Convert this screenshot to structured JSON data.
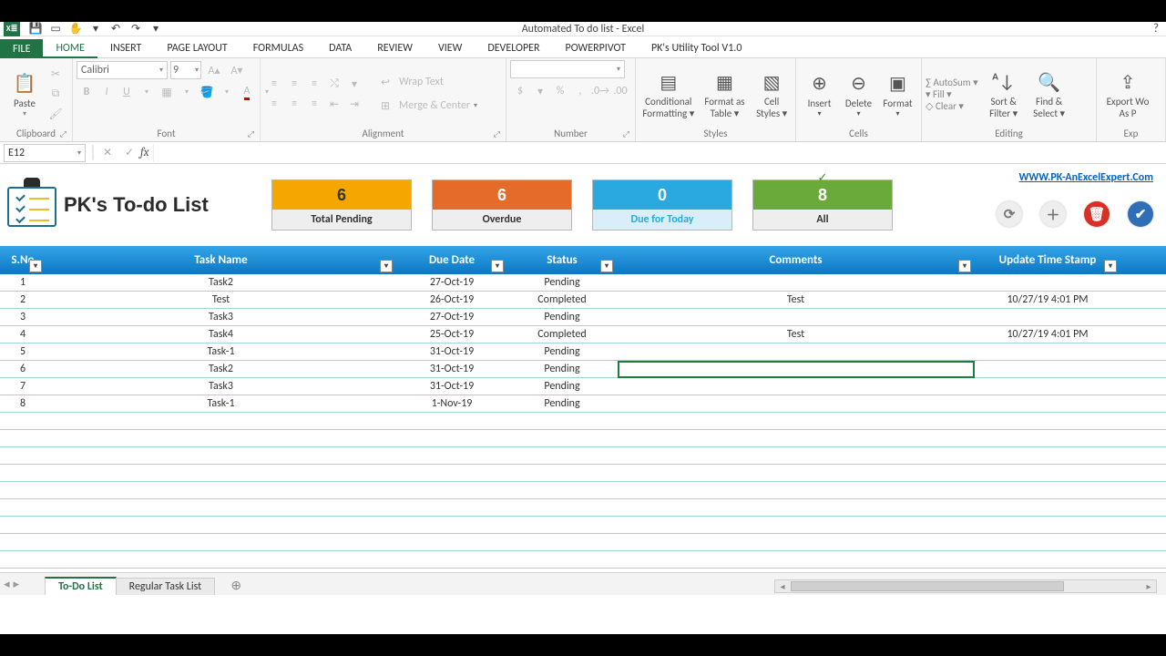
{
  "app_title": "Automated To do list - Excel",
  "qat": {
    "items": [
      "save-icon",
      "quickprint-icon",
      "touch-icon",
      "new-icon",
      "undo-icon",
      "redo-icon",
      "customize-icon"
    ]
  },
  "tabs": [
    "FILE",
    "HOME",
    "INSERT",
    "PAGE LAYOUT",
    "FORMULAS",
    "DATA",
    "REVIEW",
    "VIEW",
    "DEVELOPER",
    "POWERPIVOT",
    "PK's Utility Tool V1.0"
  ],
  "active_tab": "HOME",
  "font": {
    "name": "Calibri",
    "size": "9"
  },
  "ribbon_groups": {
    "clipboard": "Clipboard",
    "font": "Font",
    "alignment": "Alignment",
    "number": "Number",
    "styles": "Styles",
    "cells": "Cells",
    "editing": "Editing",
    "export": "Exp"
  },
  "ribbon_labels": {
    "paste": "Paste",
    "wrap": "Wrap Text",
    "merge": "Merge & Center",
    "cond_fmt1": "Conditional",
    "cond_fmt2": "Formatting",
    "fmt_tbl1": "Format as",
    "fmt_tbl2": "Table",
    "cell_st1": "Cell",
    "cell_st2": "Styles",
    "insert": "Insert",
    "delete": "Delete",
    "format": "Format",
    "autosum": "AutoSum",
    "fill": "Fill",
    "clear": "Clear",
    "sortfilt1": "Sort &",
    "sortfilt2": "Filter",
    "findsel1": "Find &",
    "findsel2": "Select",
    "export1": "Export Wo",
    "export2": "As P"
  },
  "name_box": "E12",
  "todo": {
    "title": "PK's To-do List",
    "link": "WWW.PK-AnExcelExpert.Com",
    "cards": {
      "pending": {
        "value": "6",
        "label": "Total Pending"
      },
      "overdue": {
        "value": "6",
        "label": "Overdue"
      },
      "today": {
        "value": "0",
        "label": "Due for Today"
      },
      "all": {
        "value": "8",
        "label": "All"
      }
    }
  },
  "columns": {
    "sno": "S.No",
    "task": "Task Name",
    "due": "Due Date",
    "status": "Status",
    "comments": "Comments",
    "ts": "Update Time Stamp"
  },
  "rows": [
    {
      "sno": "1",
      "task": "Task2",
      "due": "27-Oct-19",
      "status": "Pending",
      "comments": "",
      "ts": ""
    },
    {
      "sno": "2",
      "task": "Test",
      "due": "26-Oct-19",
      "status": "Completed",
      "comments": "Test",
      "ts": "10/27/19 4:01 PM"
    },
    {
      "sno": "3",
      "task": "Task3",
      "due": "27-Oct-19",
      "status": "Pending",
      "comments": "",
      "ts": ""
    },
    {
      "sno": "4",
      "task": "Task4",
      "due": "25-Oct-19",
      "status": "Completed",
      "comments": "Test",
      "ts": "10/27/19 4:01 PM"
    },
    {
      "sno": "5",
      "task": "Task-1",
      "due": "31-Oct-19",
      "status": "Pending",
      "comments": "",
      "ts": ""
    },
    {
      "sno": "6",
      "task": "Task2",
      "due": "31-Oct-19",
      "status": "Pending",
      "comments": "",
      "ts": ""
    },
    {
      "sno": "7",
      "task": "Task3",
      "due": "31-Oct-19",
      "status": "Pending",
      "comments": "",
      "ts": ""
    },
    {
      "sno": "8",
      "task": "Task-1",
      "due": "1-Nov-19",
      "status": "Pending",
      "comments": "",
      "ts": ""
    }
  ],
  "sheet_tabs": {
    "active": "To-Do List",
    "other": "Regular Task List"
  }
}
